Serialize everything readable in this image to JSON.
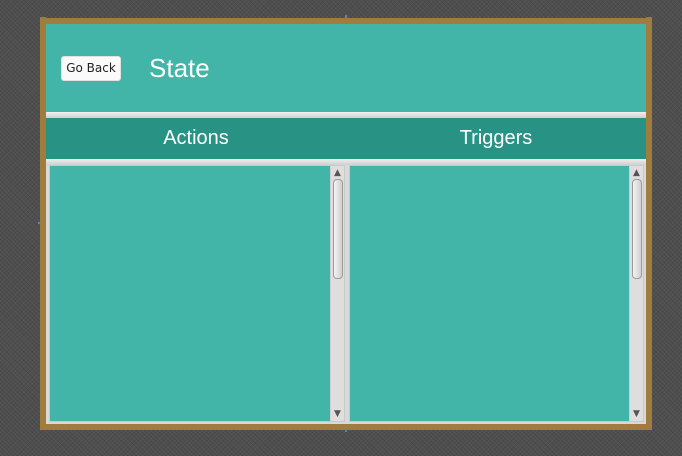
{
  "header": {
    "back_button_label": "Go Back",
    "title": "State"
  },
  "tabs": [
    {
      "label": "Actions"
    },
    {
      "label": "Triggers"
    }
  ],
  "lists": {
    "actions": {
      "items": []
    },
    "triggers": {
      "items": []
    }
  },
  "icons": {
    "scroll_up": "▲",
    "scroll_down": "▼"
  },
  "colors": {
    "header_bg": "#42b5a8",
    "tabbar_bg": "#289385",
    "list_bg": "#42b5a8",
    "window_frame": "#a07c3e"
  }
}
